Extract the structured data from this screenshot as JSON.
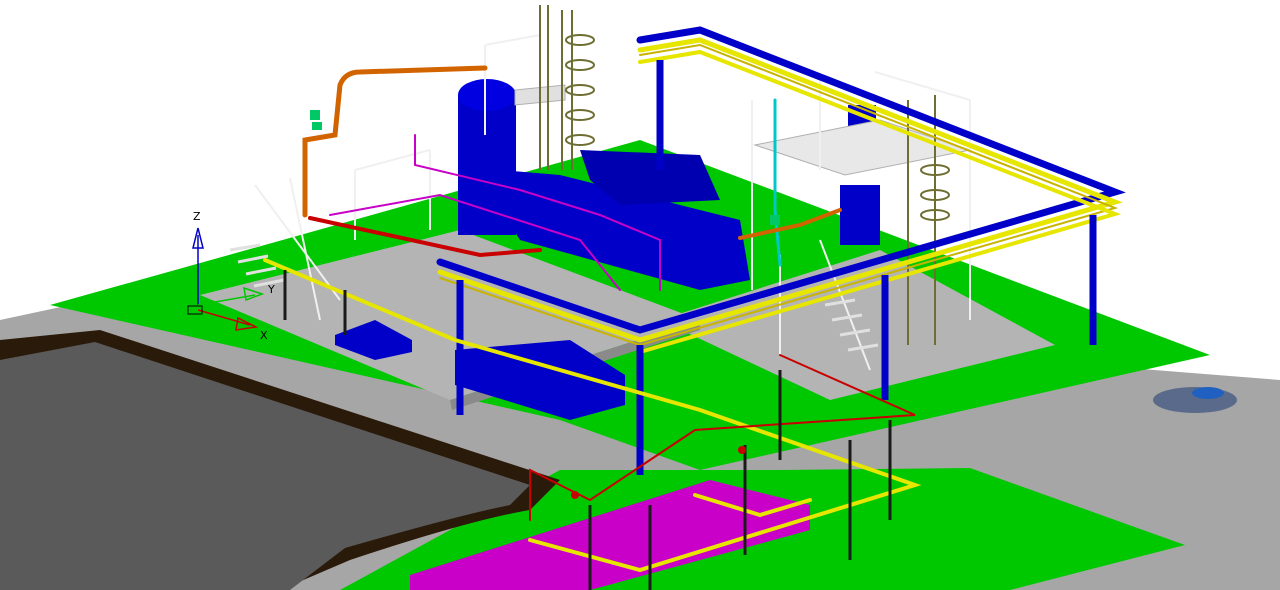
{
  "viewport": {
    "axis_labels": {
      "z": "Z",
      "y": "Y",
      "x": "X"
    },
    "colors": {
      "background": "#ffffff",
      "ground_gray": "#a6a6a6",
      "grass_green": "#00c800",
      "slab_gray": "#b4b4b4",
      "vessel_blue": "#0000c8",
      "pipe_yellow": "#e6e600",
      "pipe_red": "#c80000",
      "pipe_magenta": "#c800c8",
      "pipe_orange": "#d26400",
      "pipe_cyan": "#00c8c8",
      "railing_white": "#f0f0f0",
      "ladder_olive": "#6e6e32",
      "pond_dark": "#5a5a5a",
      "pond_rim": "#2a1a0a",
      "manhole_blue": "#2060c0",
      "pad_magenta": "#c800c8"
    },
    "icons": [
      "ucs-axis-icon"
    ]
  }
}
